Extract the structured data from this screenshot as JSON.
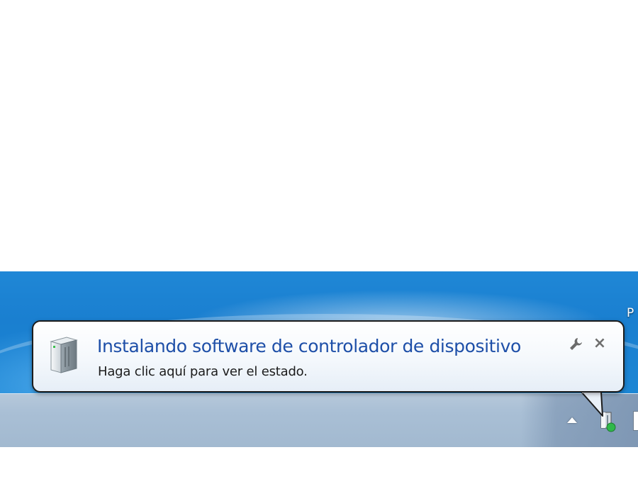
{
  "desktop": {
    "partial_label": "P"
  },
  "notification": {
    "title": "Instalando software de controlador de dispositivo",
    "subtitle": "Haga clic aquí para ver el estado.",
    "icon": "device-icon",
    "options_icon": "wrench-icon",
    "close_label": "×"
  },
  "taskbar": {
    "tray_icons": [
      "show-hidden-icons-arrow",
      "device-install-icon"
    ]
  },
  "colors": {
    "title": "#1e4fa8",
    "desktop_blue": "#1f87d6",
    "taskbar": "#a9bfd5",
    "status_green": "#2fb84a"
  }
}
